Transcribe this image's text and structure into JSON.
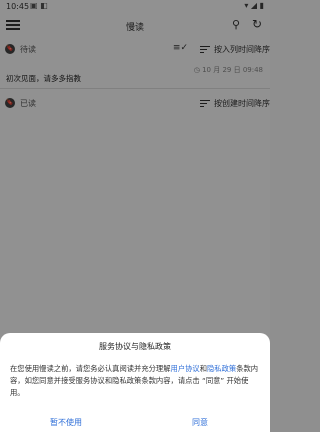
{
  "status": {
    "time": "10:45",
    "left_icons": "▣ ◧",
    "right_icons": "▾ ◢ ▮"
  },
  "appbar": {
    "title": "慢读"
  },
  "sections": [
    {
      "label": "待读",
      "sort_label": "按入列时间降序"
    },
    {
      "label": "已读",
      "sort_label": "按创建时间降序"
    }
  ],
  "item": {
    "time": "◷ 10 月 29 日 09:48",
    "title": "初次见面，请多多指教"
  },
  "dialog": {
    "title": "服务协议与隐私政策",
    "body_part1": "在您使用慢读之前，请您务必认真阅读并充分理解",
    "link1": "用户协议",
    "and": "和",
    "link2": "隐私政策",
    "body_part2": "条款内容，如您同意并接受服务协议和隐私政策条款内容，请点击 “同意” 开始使用。",
    "decline": "暂不使用",
    "accept": "同意"
  },
  "colors": {
    "accent": "#2f6fd8",
    "overlay": "rgba(0,0,0,0.42)"
  }
}
